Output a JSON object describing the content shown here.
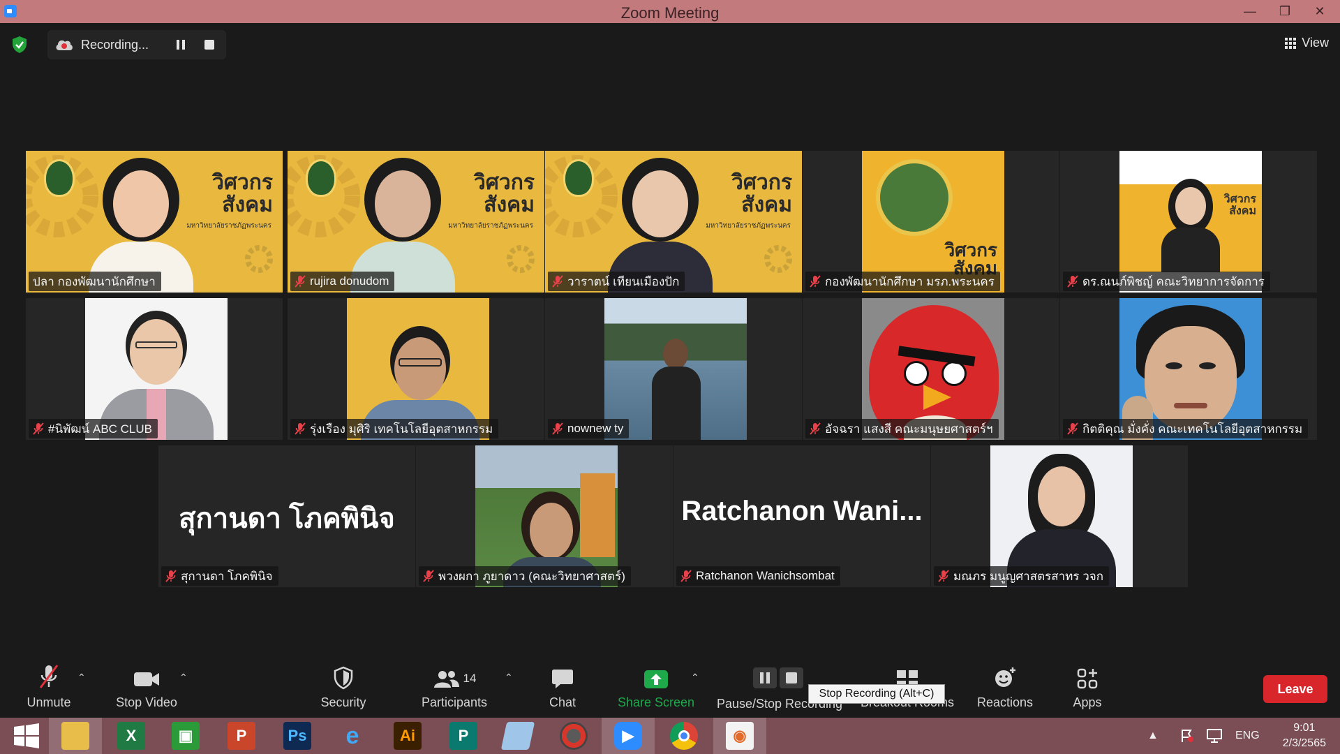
{
  "window": {
    "title": "Zoom Meeting"
  },
  "topbar": {
    "recording_label": "Recording...",
    "view_label": "View"
  },
  "participants": [
    {
      "name": "ปลา กองพัฒนานักศึกษา",
      "muted": false,
      "active": true,
      "kind": "banner"
    },
    {
      "name": "rujira donudom",
      "muted": true,
      "kind": "banner"
    },
    {
      "name": "วาราตน์ เทียนเมืองปัก",
      "muted": true,
      "kind": "banner"
    },
    {
      "name": "กองพัฒนานักศึกษา มรภ.พระนคร",
      "muted": true,
      "kind": "logo"
    },
    {
      "name": "ดร.ณนภ์พิชญ์ คณะวิทยาการจัดการ",
      "muted": true,
      "kind": "poster"
    },
    {
      "name": "#นิพัฒน์ ABC CLUB",
      "muted": true,
      "kind": "portrait"
    },
    {
      "name": "รุ่งเรือง มุศิริ เทคโนโลยีอุตสาหกรรม",
      "muted": true,
      "kind": "banner-man"
    },
    {
      "name": "nownew ty",
      "muted": true,
      "kind": "lake"
    },
    {
      "name": "อัจฉรา แสงสี คณะมนุษยศาสตร์ฯ",
      "muted": true,
      "kind": "bird"
    },
    {
      "name": "กิตติคุณ มั่งคั่ง คณะเทคโนโลยีอุตสาหกรรม",
      "muted": true,
      "kind": "drawing"
    },
    {
      "name": "สุกานดา โภคพินิจ",
      "muted": true,
      "kind": "text",
      "display": "สุกานดา โภคพินิจ"
    },
    {
      "name": "พวงผกา ภูยาดาว (คณะวิทยาศาสตร์)",
      "muted": true,
      "kind": "outdoor"
    },
    {
      "name": "Ratchanon Wanichsombat",
      "muted": true,
      "kind": "text",
      "display": "Ratchanon Wani..."
    },
    {
      "name": "มณภร มนูญศาสตรสาทร วจก",
      "muted": true,
      "kind": "woman"
    }
  ],
  "banner": {
    "title_top": "วิศวกร",
    "title_bottom": "สังคม",
    "subtitle": "มหาวิทยาลัยราชภัฏพระนคร"
  },
  "toolbar": {
    "unmute": "Unmute",
    "stop_video": "Stop Video",
    "security": "Security",
    "participants": "Participants",
    "participants_count": "14",
    "chat": "Chat",
    "share_screen": "Share Screen",
    "pause_stop_recording": "Pause/Stop Recording",
    "breakout_rooms": "Breakout Rooms",
    "reactions": "Reactions",
    "apps": "Apps",
    "leave": "Leave",
    "tooltip": "Stop Recording (Alt+C)"
  },
  "taskbar": {
    "apps": [
      "Start",
      "File Explorer",
      "Excel",
      "Store",
      "PowerPoint",
      "Photoshop",
      "Internet Explorer",
      "Illustrator",
      "Publisher",
      "Notes",
      "Photoscape",
      "Zoom",
      "Chrome",
      "Photos"
    ],
    "language": "ENG",
    "time": "9:01",
    "date": "2/3/2565"
  },
  "colors": {
    "active_speaker": "#b8e986",
    "share_green": "#1ea94b",
    "leave_red": "#d9262b",
    "titlebar": "#c27a7c",
    "taskbar": "#7b4d55"
  }
}
